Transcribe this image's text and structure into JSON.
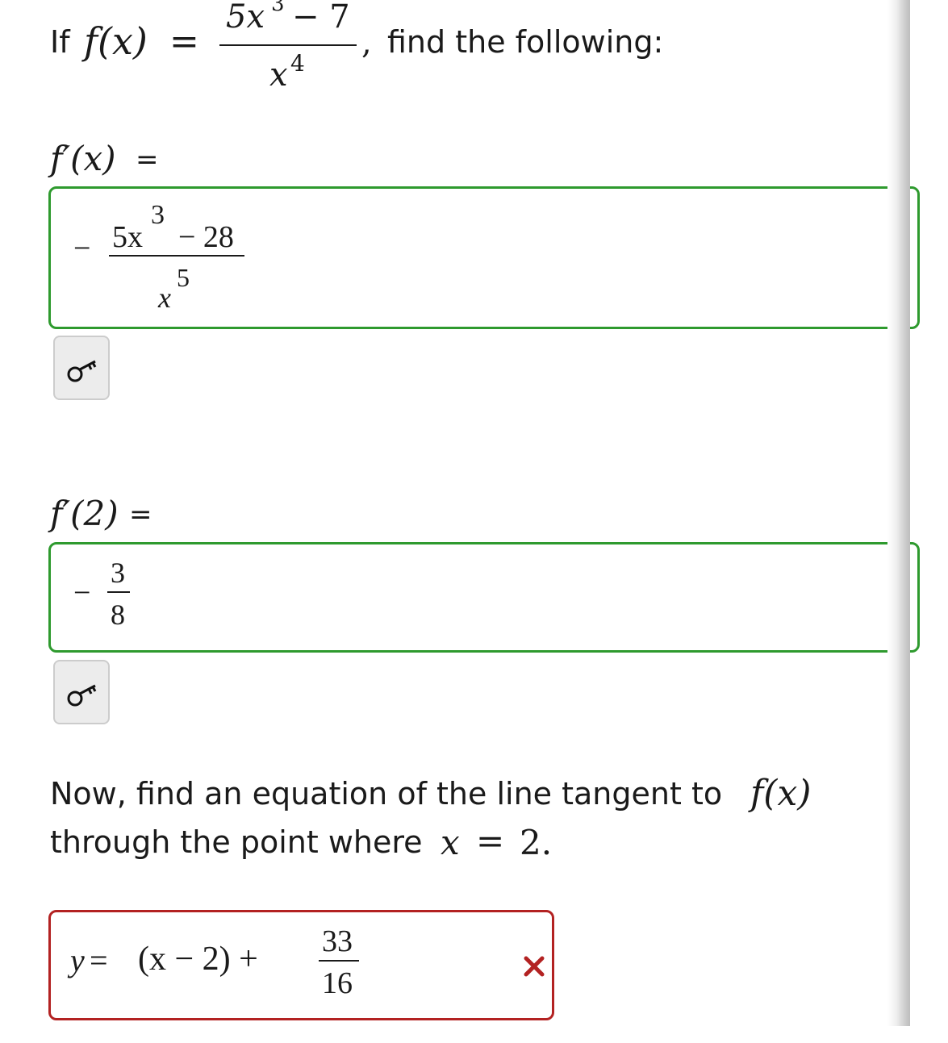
{
  "intro": {
    "prefix": "If",
    "fn": "f(x)",
    "equals": "=",
    "numerator": "5x",
    "num_exp": "3",
    "num_rest": "− 7",
    "denominator": "x",
    "den_exp": "4",
    "comma": ",",
    "suffix": "find the following:"
  },
  "q1": {
    "label": "f′(x)",
    "equals": "=",
    "answer": {
      "sign": "−",
      "num_base": "5x",
      "num_exp": "3",
      "num_rest": "− 28",
      "den_base": "x",
      "den_exp": "5"
    },
    "key_icon": "key-icon"
  },
  "q2": {
    "label": "f′(2)",
    "equals": "=",
    "answer": {
      "sign": "−",
      "num": "3",
      "den": "8"
    },
    "key_icon": "key-icon"
  },
  "q3": {
    "prompt_line1": "Now, find an equation of the line tangent to",
    "prompt_fn": "f(x)",
    "prompt_line2": "through the point where",
    "prompt_var": "x",
    "prompt_eq": "=",
    "prompt_val": "2.",
    "answer": {
      "lhs": "y",
      "eq": "=",
      "body": "(x − 2) +",
      "num": "33",
      "den": "16"
    },
    "status_icon": "x-mark-icon",
    "status": "incorrect"
  },
  "colors": {
    "correct": "#2e9a2e",
    "incorrect": "#b32222",
    "button_bg": "#ececec"
  }
}
